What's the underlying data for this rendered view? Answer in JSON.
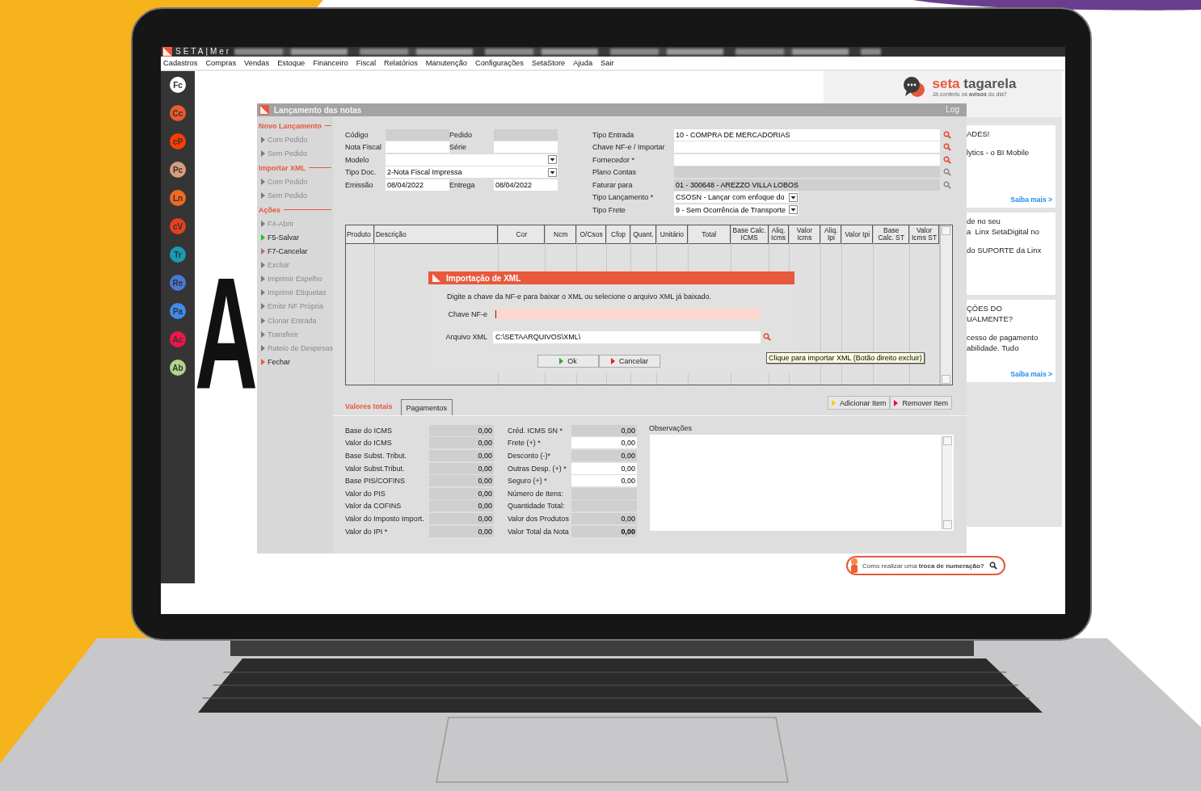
{
  "app_title": "SETA|Mer",
  "menu": [
    "Cadastros",
    "Compras",
    "Vendas",
    "Estoque",
    "Financeiro",
    "Fiscal",
    "Relatórios",
    "Manutenção",
    "Configurações",
    "SetaStore",
    "Ajuda",
    "Sair"
  ],
  "dock": [
    {
      "label": "Fc",
      "color": "#ffffff"
    },
    {
      "label": "Cc",
      "color": "#ec5a2e"
    },
    {
      "label": "cP",
      "color": "#ff3d00"
    },
    {
      "label": "Pc",
      "color": "#d99c7c"
    },
    {
      "label": "Ln",
      "color": "#f26a22"
    },
    {
      "label": "cV",
      "color": "#e8401c"
    },
    {
      "label": "Tr",
      "color": "#1a9bb5"
    },
    {
      "label": "Re",
      "color": "#4a78d6"
    },
    {
      "label": "Pa",
      "color": "#3f8cf0"
    },
    {
      "label": "Ac",
      "color": "#f0154a"
    },
    {
      "label": "Ab",
      "color": "#b5d48a"
    }
  ],
  "background_letter": "A",
  "news_panel": {
    "brand_first": "seta",
    "brand_second": "tagarela",
    "tagline": "Já conferiu os **avisos** do dia?",
    "cards": [
      {
        "paragraphs": [
          [
            "ADES!"
          ],
          [
            "lytics - o BI Mobile"
          ]
        ],
        "link": "Saiba mais >"
      },
      {
        "paragraphs": [
          [
            "de no seu",
            "a  Linx SetaDigital no"
          ],
          [
            "do SUPORTE da Linx"
          ]
        ]
      },
      {
        "paragraphs": [
          [
            "ÇÕES DO",
            "UALMENTE?"
          ],
          [
            "cesso de pagamento",
            "abilidade. Tudo"
          ]
        ],
        "link": "Saiba mais >"
      }
    ],
    "help_search": "Como realizar uma **troca de numeração?**"
  },
  "window": {
    "title": "Lançamento das notas",
    "log": "Log",
    "nav": [
      {
        "heading": "Novo Lançamento",
        "items": [
          {
            "label": "Com Pedido",
            "disabled": true,
            "color": "#7a7a7a"
          },
          {
            "label": "Sem Pedido",
            "disabled": true,
            "color": "#7a7a7a"
          }
        ]
      },
      {
        "heading": "Importar XML",
        "items": [
          {
            "label": "Com Pedido",
            "disabled": true,
            "color": "#7a7a7a"
          },
          {
            "label": "Sem Pedido",
            "disabled": true,
            "color": "#7a7a7a"
          }
        ]
      },
      {
        "heading": "Ações",
        "items": [
          {
            "label": "F4-Abrir",
            "disabled": true,
            "color": "#7a7a7a"
          },
          {
            "label": "F5-Salvar",
            "disabled": false,
            "color": "#1fbf1f"
          },
          {
            "label": "F7-Cancelar",
            "disabled": false,
            "color": "#b0707a"
          },
          {
            "label": "Excluir",
            "disabled": true,
            "color": "#7a7a7a"
          },
          {
            "label": "Imprimir Espelho",
            "disabled": true,
            "color": "#7a7a7a"
          },
          {
            "label": "Imprimir Etiquetas",
            "disabled": true,
            "color": "#7a7a7a"
          },
          {
            "label": "Emitir NF Própria",
            "disabled": true,
            "color": "#7a7a7a"
          },
          {
            "label": "Clonar Entrada",
            "disabled": true,
            "color": "#7a7a7a"
          },
          {
            "label": "Transferir",
            "disabled": true,
            "color": "#7a7a7a"
          },
          {
            "label": "Rateio de Despesas",
            "disabled": true,
            "color": "#7a7a7a"
          },
          {
            "label": "Fechar",
            "disabled": false,
            "color": "#f0602a"
          }
        ]
      }
    ],
    "form_left": [
      {
        "label": "Código",
        "kind": "text",
        "disabled": true
      },
      {
        "label": "Pedido",
        "kind": "text",
        "disabled": true
      },
      {
        "label": "Nota Fiscal",
        "kind": "text",
        "disabled": false
      },
      {
        "label": "Série",
        "kind": "text",
        "disabled": false
      },
      {
        "label": "Modelo",
        "kind": "dropdown",
        "disabled": false
      },
      {
        "label": "Tipo Doc.",
        "kind": "dropdown",
        "disabled": false,
        "value": "2-Nota Fiscal Impressa"
      },
      {
        "label": "Emissão",
        "kind": "text",
        "disabled": false,
        "value": "08/04/2022"
      },
      {
        "label": "Entrega",
        "kind": "text",
        "disabled": false,
        "value": "08/04/2022"
      }
    ],
    "form_right": [
      {
        "label": "Tipo Entrada",
        "kind": "lookup",
        "disabled": false,
        "value": "10 - COMPRA DE MERCADORIAS"
      },
      {
        "label": "Chave NF-e / Importar",
        "kind": "lookup",
        "disabled": false
      },
      {
        "label": "Fornecedor *",
        "kind": "lookup",
        "disabled": false
      },
      {
        "label": "Plano Contas",
        "kind": "lookup",
        "disabled": true
      },
      {
        "label": "Faturar para",
        "kind": "lookup",
        "disabled": true,
        "value": "01 - 300648 - AREZZO VILLA LOBOS"
      },
      {
        "label": "Tipo Lançamento *",
        "kind": "dropdown",
        "disabled": false,
        "value": "CSOSN - Lançar com enfoque do"
      },
      {
        "label": "Tipo Frete",
        "kind": "dropdown",
        "disabled": false,
        "value": "9 - Sem Ocorrência de Transporte"
      }
    ],
    "grid_columns": [
      "Produto",
      "Descrição",
      "Cor",
      "Ncm",
      "O/Csos",
      "Cfop",
      "Quant.",
      "Unitário",
      "Total",
      "Base Calc. ICMS",
      "Aliq. Icms",
      "Valor Icms",
      "Aliq. Ipi",
      "Valor Ipi",
      "Base Calc. ST",
      "Valor Icms ST"
    ],
    "dialog": {
      "title": "Importação de XML",
      "instruction": "Digite a chave da NF-e para baixar o XML ou selecione o arquivo XML já baixado.",
      "fields": [
        {
          "label": "Chave NF-e",
          "focused": true
        },
        {
          "label": "Arquivo XML",
          "focused": false,
          "value": "C:\\SETAARQUIVOS\\XML\\"
        }
      ],
      "buttons": [
        {
          "label": "Ok",
          "color": "#1fae2a"
        },
        {
          "label": "Cancelar",
          "color": "#e0202a"
        }
      ],
      "tooltip": "Clique para importar XML (Botão direito excluir)"
    },
    "tabs": [
      {
        "label": "Valores totais",
        "selected": true
      },
      {
        "label": "Pagamentos",
        "selected": false
      }
    ],
    "actions": [
      {
        "label": "Adicionar Item",
        "color": "#f0d000"
      },
      {
        "label": "Remover Item",
        "color": "#e0103a"
      }
    ],
    "totals_left": [
      {
        "label": "Base do ICMS",
        "value": "0,00",
        "editable": false
      },
      {
        "label": "Valor do ICMS",
        "value": "0,00",
        "editable": false
      },
      {
        "label": "Base Subst. Tribut.",
        "value": "0,00",
        "editable": false
      },
      {
        "label": "Valor Subst.Tribut.",
        "value": "0,00",
        "editable": false
      },
      {
        "label": "Base PIS/COFINS",
        "value": "0,00",
        "editable": false
      },
      {
        "label": "Valor do PIS",
        "value": "0,00",
        "editable": false
      },
      {
        "label": "Valor da COFINS",
        "value": "0,00",
        "editable": false
      },
      {
        "label": "Valor do Imposto Import.",
        "value": "0,00",
        "editable": false
      },
      {
        "label": "Valor do IPI *",
        "value": "0,00",
        "editable": false
      }
    ],
    "totals_right": [
      {
        "label": "Créd. ICMS SN *",
        "value": "0,00",
        "editable": false
      },
      {
        "label": "Frete (+) *",
        "value": "0,00",
        "editable": true
      },
      {
        "label": "Desconto (-)*",
        "value": "0,00",
        "editable": false
      },
      {
        "label": "Outras Desp. (+) *",
        "value": "0,00",
        "editable": true
      },
      {
        "label": "Seguro (+) *",
        "value": "0,00",
        "editable": true
      },
      {
        "label": "Número de Itens:",
        "editable": false
      },
      {
        "label": "Quantidade Total:",
        "editable": false
      },
      {
        "label": "Valor dos Produtos",
        "value": "0,00",
        "editable": false
      },
      {
        "label": "Valor Total da Nota",
        "value": "0,00",
        "editable": false,
        "bold": true
      }
    ],
    "observations": "Observações"
  }
}
